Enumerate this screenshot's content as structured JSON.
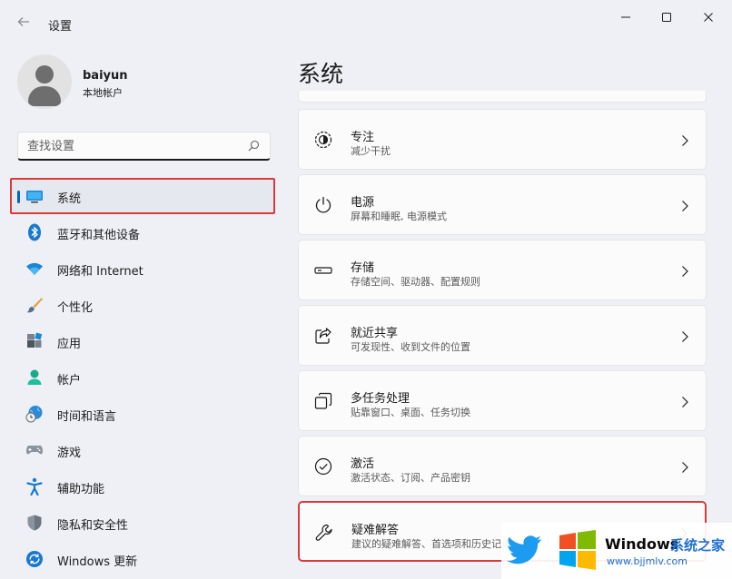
{
  "window": {
    "title": "设置",
    "back_icon": "back-arrow-icon",
    "controls": [
      "minimize-icon",
      "maximize-icon",
      "close-icon"
    ]
  },
  "user": {
    "name": "baiyun",
    "account_type": "本地帐户"
  },
  "search": {
    "placeholder": "查找设置",
    "value": ""
  },
  "sidebar": {
    "items": [
      {
        "label": "系统",
        "icon": "system-icon",
        "active": true
      },
      {
        "label": "蓝牙和其他设备",
        "icon": "bluetooth-icon"
      },
      {
        "label": "网络和 Internet",
        "icon": "network-icon"
      },
      {
        "label": "个性化",
        "icon": "personalization-icon"
      },
      {
        "label": "应用",
        "icon": "apps-icon"
      },
      {
        "label": "帐户",
        "icon": "accounts-icon"
      },
      {
        "label": "时间和语言",
        "icon": "time-language-icon"
      },
      {
        "label": "游戏",
        "icon": "gaming-icon"
      },
      {
        "label": "辅助功能",
        "icon": "accessibility-icon"
      },
      {
        "label": "隐私和安全性",
        "icon": "privacy-icon"
      },
      {
        "label": "Windows 更新",
        "icon": "windows-update-icon"
      }
    ]
  },
  "main": {
    "title": "系统",
    "cards": [
      {
        "title": "专注",
        "desc": "减少干扰",
        "icon": "focus-icon"
      },
      {
        "title": "电源",
        "desc": "屏幕和睡眠, 电源模式",
        "icon": "power-icon"
      },
      {
        "title": "存储",
        "desc": "存储空间、驱动器、配置规则",
        "icon": "storage-icon"
      },
      {
        "title": "就近共享",
        "desc": "可发现性、收到文件的位置",
        "icon": "share-icon"
      },
      {
        "title": "多任务处理",
        "desc": "贴靠窗口、桌面、任务切换",
        "icon": "multitasking-icon"
      },
      {
        "title": "激活",
        "desc": "激活状态、订阅、产品密钥",
        "icon": "activation-icon"
      },
      {
        "title": "疑难解答",
        "desc": "建议的疑难解答、首选项和历史记录",
        "icon": "troubleshoot-icon",
        "highlight": true
      }
    ]
  },
  "watermark": {
    "brand": "Windows",
    "brand_suffix": "系统之家",
    "url": "www.bjjmlv.com"
  },
  "colors": {
    "accent": "#0067c0",
    "highlight_border": "#d93a3a",
    "background": "#eef0f6",
    "card": "#fbfbfb"
  }
}
